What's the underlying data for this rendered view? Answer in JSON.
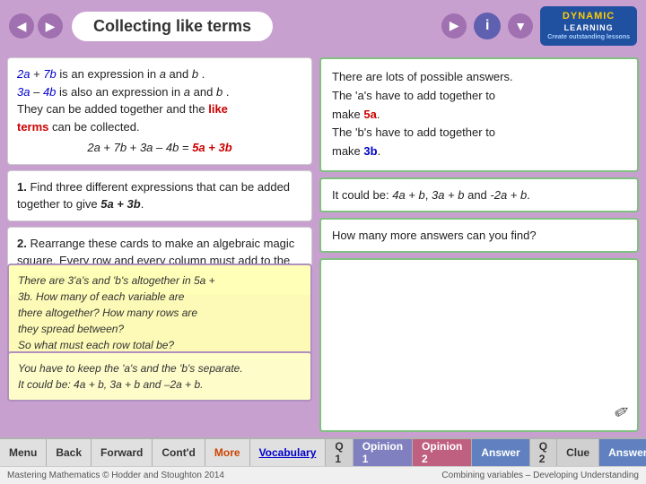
{
  "header": {
    "title": "Collecting like terms",
    "info_symbol": "i",
    "logo": {
      "dynamic": "DYNAMIC",
      "learning": "LEARNING",
      "tagline": "Create outstanding lessons"
    }
  },
  "left": {
    "intro": {
      "line1": "2a + 7b is an expression in a and b.",
      "line2": "3a – 4b is also an expression in a and b.",
      "line3": "They can be added together and the like",
      "line3b": "terms can be collected.",
      "equation": "2a + 7b  +  3a – 4b  =  5a + 3b"
    },
    "question1": {
      "number": "1.",
      "text": "Find three different expressions that can be added together to give 5a + 3b."
    },
    "question2": {
      "number": "2.",
      "text": "Rearrange these cards to make an algebraic magic square. Every row and every column must add to the same amount."
    },
    "hint1": {
      "line1": "There are 3'a's and 'b's altogether in 5a +",
      "line2": "3b. How many of each variable are",
      "line3": "there altogether? How many rows are",
      "line4": "they spread between?",
      "line5": "So what must each row total be?"
    },
    "hint2": {
      "line1": "You have to keep the 'a's and the 'b's separate.",
      "line2": "It could be: 4a + b, 3a + b and –2a + b."
    }
  },
  "right": {
    "answer_box": {
      "line1": "There are lots of possible answers.",
      "line2": "The 'a's have to add together to",
      "line3": "make 5a.",
      "line4": "The 'b's have to add together to",
      "line5": "make 3b."
    },
    "example": "It could be: 4a + b, 3a + b and -2a + b.",
    "more_question": "How many more answers can you find?"
  },
  "nav": {
    "menu": "Menu",
    "back": "Back",
    "forward": "Forward",
    "contd": "Cont'd",
    "more": "More",
    "vocabulary": "Vocabulary",
    "q1": "Q 1",
    "opinion1": "Opinion 1",
    "opinion2": "Opinion 2",
    "answer": "Answer",
    "q2": "Q 2",
    "clue": "Clue",
    "answer2": "Answer"
  },
  "footer": {
    "left": "Mastering Mathematics © Hodder and Stoughton 2014",
    "right": "Combining variables – Developing Understanding"
  }
}
